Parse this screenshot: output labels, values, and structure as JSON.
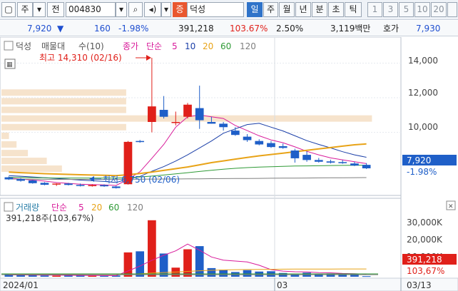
{
  "toolbar": {
    "market_select": "주",
    "prev_label": "전",
    "code_value": "004830",
    "stock_name": "덕성",
    "badge": "증",
    "period_tabs": [
      "일",
      "주",
      "월",
      "년",
      "분",
      "초",
      "틱"
    ],
    "active_tab": "일",
    "number_tabs": [
      "1",
      "3",
      "5",
      "10",
      "20"
    ]
  },
  "price_bar": {
    "price": "7,920",
    "change": "160",
    "change_pct": "-1.98%",
    "volume": "391,218",
    "volume_ratio": "103.67%",
    "turnover_ratio": "2.50%",
    "amount": "3,119백만",
    "quote_label": "호가",
    "quote_value": "7,930"
  },
  "price_panel": {
    "title_parts": [
      "덕성",
      "매물대",
      "수(10)",
      "종가",
      "단순",
      "5",
      "10",
      "20",
      "60",
      "120"
    ],
    "high_annotation": "최고 14,310 (02/16)",
    "low_annotation": "최저 6,750 (02/06)",
    "current_price_tag": "7,920",
    "current_change_tag": "-1.98%",
    "y_ticks": [
      "14,000",
      "12,000",
      "10,000"
    ]
  },
  "volume_panel": {
    "title_parts": [
      "거래량",
      "단순",
      "5",
      "20",
      "60",
      "120"
    ],
    "summary": "391,218주(103,67%)",
    "current_volume_tag": "391,218",
    "current_ratio_tag": "103,67%",
    "y_ticks": [
      "30,000K",
      "20,000K",
      "10,000K"
    ]
  },
  "x_axis": {
    "labels": [
      "2024/01",
      "03",
      "03/13"
    ]
  },
  "colors": {
    "up": "#e0201a",
    "down": "#1f5fc8",
    "ma5": "#d81b9a",
    "ma10": "#1b3fa8",
    "ma20": "#e8a317",
    "ma60": "#2f9a36",
    "ma120": "#7f7f7f",
    "volume_profile": "#f6e3cc"
  },
  "chart_data": {
    "type": "candlestick",
    "price_range": [
      6600,
      14600
    ],
    "candles": [
      {
        "o": 7400,
        "h": 7450,
        "l": 7250,
        "c": 7280
      },
      {
        "o": 7300,
        "h": 7350,
        "l": 7150,
        "c": 7200
      },
      {
        "o": 7220,
        "h": 7250,
        "l": 7030,
        "c": 7060
      },
      {
        "o": 7080,
        "h": 7120,
        "l": 6940,
        "c": 6970
      },
      {
        "o": 6980,
        "h": 7060,
        "l": 6900,
        "c": 7040
      },
      {
        "o": 7040,
        "h": 7080,
        "l": 6930,
        "c": 6960
      },
      {
        "o": 6960,
        "h": 7040,
        "l": 6870,
        "c": 6900
      },
      {
        "o": 6920,
        "h": 7000,
        "l": 6860,
        "c": 6950
      },
      {
        "o": 6950,
        "h": 6990,
        "l": 6850,
        "c": 6880
      },
      {
        "o": 6870,
        "h": 6900,
        "l": 6750,
        "c": 6780
      },
      {
        "o": 7000,
        "h": 9500,
        "l": 6980,
        "c": 9450
      },
      {
        "o": 9500,
        "h": 9560,
        "l": 9400,
        "c": 9470
      },
      {
        "o": 10600,
        "h": 14310,
        "l": 10000,
        "c": 11500
      },
      {
        "o": 11300,
        "h": 12100,
        "l": 10800,
        "c": 10900
      },
      {
        "o": 10600,
        "h": 11200,
        "l": 10400,
        "c": 10600
      },
      {
        "o": 10900,
        "h": 11700,
        "l": 10800,
        "c": 11600
      },
      {
        "o": 11400,
        "h": 12700,
        "l": 10200,
        "c": 10700
      },
      {
        "o": 10600,
        "h": 10900,
        "l": 10500,
        "c": 10500
      },
      {
        "o": 10500,
        "h": 10600,
        "l": 10100,
        "c": 10300
      },
      {
        "o": 10100,
        "h": 10300,
        "l": 9800,
        "c": 9850
      },
      {
        "o": 9750,
        "h": 9900,
        "l": 9450,
        "c": 9550
      },
      {
        "o": 9500,
        "h": 9600,
        "l": 9250,
        "c": 9300
      },
      {
        "o": 9380,
        "h": 9500,
        "l": 9100,
        "c": 9150
      },
      {
        "o": 9200,
        "h": 9350,
        "l": 9050,
        "c": 9100
      },
      {
        "o": 8950,
        "h": 9050,
        "l": 8250,
        "c": 8500
      },
      {
        "o": 8700,
        "h": 8900,
        "l": 8300,
        "c": 8400
      },
      {
        "o": 8400,
        "h": 8520,
        "l": 8250,
        "c": 8300
      },
      {
        "o": 8320,
        "h": 8420,
        "l": 8200,
        "c": 8250
      },
      {
        "o": 8280,
        "h": 8400,
        "l": 8180,
        "c": 8220
      },
      {
        "o": 8200,
        "h": 8300,
        "l": 8050,
        "c": 8080
      },
      {
        "o": 8120,
        "h": 8220,
        "l": 7880,
        "c": 7920
      }
    ],
    "volumes_k": [
      1600,
      1100,
      900,
      800,
      700,
      750,
      700,
      650,
      600,
      800,
      15500,
      16200,
      36000,
      14800,
      5800,
      17500,
      19500,
      5500,
      4500,
      3000,
      4200,
      3300,
      3500,
      2400,
      1500,
      2600,
      2000,
      2100,
      1500,
      1600,
      391
    ],
    "ma": {
      "ma5": [
        7350,
        7300,
        7240,
        7180,
        7100,
        7050,
        7000,
        6980,
        6960,
        6930,
        7280,
        7720,
        8500,
        9300,
        10300,
        10900,
        11000,
        10900,
        10800,
        10400,
        10100,
        9800,
        9560,
        9400,
        9160,
        8900,
        8700,
        8520,
        8410,
        8300,
        8190
      ],
      "ma10": [
        7500,
        7460,
        7420,
        7380,
        7330,
        7290,
        7240,
        7200,
        7160,
        7100,
        7300,
        7450,
        7750,
        8020,
        8340,
        8700,
        9100,
        9500,
        9950,
        10200,
        10450,
        10520,
        10300,
        10080,
        9800,
        9520,
        9300,
        9100,
        8880,
        8700,
        8560
      ],
      "ma20": [
        7700,
        7670,
        7640,
        7610,
        7590,
        7570,
        7550,
        7530,
        7520,
        7500,
        7550,
        7620,
        7700,
        7800,
        7900,
        8000,
        8120,
        8250,
        8350,
        8450,
        8550,
        8640,
        8720,
        8800,
        8880,
        8960,
        9040,
        9120,
        9200,
        9280,
        9330
      ],
      "ma60": [
        7400,
        7390,
        7380,
        7370,
        7360,
        7360,
        7360,
        7360,
        7360,
        7360,
        7380,
        7420,
        7470,
        7530,
        7600,
        7670,
        7740,
        7810,
        7870,
        7920,
        7960,
        7990,
        8010,
        8030,
        8050,
        8060,
        8070,
        8080,
        8090,
        8095,
        8100
      ],
      "ma120": [
        7300,
        7295,
        7290,
        7285,
        7280,
        7280,
        7280,
        7280,
        7280,
        7280,
        7285,
        7290,
        7295,
        7300,
        7305,
        7310,
        7315,
        7320,
        7325,
        7330,
        7335,
        7340,
        7345,
        7350,
        7355,
        7360,
        7365,
        7370,
        7375,
        7380,
        7385
      ]
    },
    "vol_ma": {
      "ma5": [
        1200,
        1150,
        1100,
        1050,
        980,
        900,
        850,
        780,
        720,
        700,
        3700,
        6800,
        10500,
        13700,
        16500,
        20800,
        16900,
        12600,
        10600,
        10000,
        9400,
        7300,
        4500,
        3600,
        3200,
        3100,
        2600,
        2500,
        2100,
        1900,
        1600
      ],
      "ma20": [
        1500,
        1480,
        1460,
        1440,
        1420,
        1400,
        1380,
        1360,
        1340,
        1320,
        1600,
        1900,
        2300,
        2700,
        3000,
        3400,
        3800,
        4100,
        4300,
        4500,
        4600,
        4700,
        4750,
        4800,
        4850,
        4880,
        4900,
        4920,
        4940,
        4950,
        4960
      ]
    },
    "volume_profile": [
      {
        "price": 12300,
        "width": 0.33
      },
      {
        "price": 11800,
        "width": 0.33
      },
      {
        "price": 11300,
        "width": 0.33
      },
      {
        "price": 10800,
        "width": 0.98
      },
      {
        "price": 10300,
        "width": 0.33
      },
      {
        "price": 9800,
        "width": 0.02
      },
      {
        "price": 9300,
        "width": 0.04
      },
      {
        "price": 8800,
        "width": 0.07
      },
      {
        "price": 8350,
        "width": 0.12
      },
      {
        "price": 7900,
        "width": 0.16
      }
    ]
  }
}
